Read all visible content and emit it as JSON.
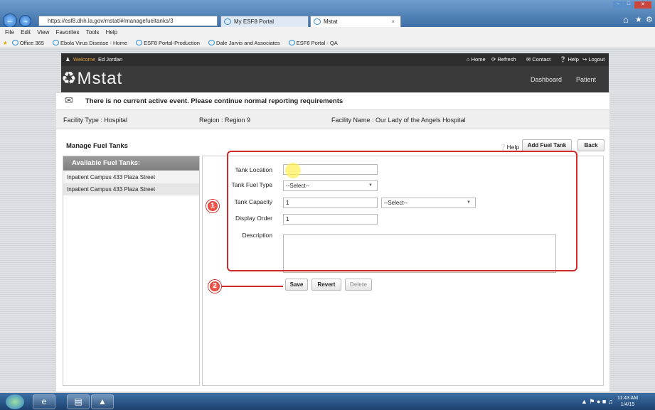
{
  "browser": {
    "url": "https://esf8.dhh.la.gov/mstat/#/managefueltanks/3",
    "tabs": [
      {
        "label": "My ESF8 Portal"
      },
      {
        "label": "Mstat"
      }
    ],
    "tab_close": "×",
    "menu": [
      "File",
      "Edit",
      "View",
      "Favorites",
      "Tools",
      "Help"
    ],
    "favorites": [
      "Office 365",
      "Ebola Virus Disease - Home",
      "ESF8 Portal-Production",
      "Dale Jarvis and Associates",
      "ESF8 Portal - QA"
    ]
  },
  "topnav": {
    "welcome": "Welcome",
    "user": "Ed Jordan",
    "links": [
      "Home",
      "Refresh",
      "Contact",
      "Help",
      "Logout"
    ]
  },
  "header": {
    "logo": "Mstat",
    "nav": [
      "Dashboard",
      "Patient"
    ]
  },
  "event_message": "There is no current active event. Please continue normal reporting requirements",
  "facility": {
    "type": "Facility Type : Hospital",
    "region": "Region : Region 9",
    "name": "Facility Name : Our Lady of the Angels Hospital"
  },
  "page": {
    "title": "Manage Fuel Tanks",
    "help": "Help",
    "add_button": "Add Fuel Tank",
    "back_button": "Back"
  },
  "tank_list": {
    "header": "Available Fuel Tanks:",
    "items": [
      "Inpatient Campus 433 Plaza Street",
      "Inpatient Campus 433 Plaza Street"
    ]
  },
  "form": {
    "location_label": "Tank Location",
    "location_value": "",
    "fuel_type_label": "Tank Fuel Type",
    "fuel_type_value": "--Select--",
    "capacity_label": "Tank Capacity",
    "capacity_value": "1",
    "capacity_unit_value": "--Select--",
    "display_order_label": "Display Order",
    "display_order_value": "1",
    "description_label": "Description",
    "description_value": "",
    "save": "Save",
    "revert": "Revert",
    "delete": "Delete"
  },
  "annotations": {
    "badge1": "1",
    "badge2": "2"
  },
  "taskbar": {
    "time": "11:43 AM",
    "date": "1/4/15"
  },
  "colors": {
    "annotation_red": "#d12a2a",
    "header_dark": "#3a3a3a",
    "topnav_dark": "#2d2d2d"
  }
}
